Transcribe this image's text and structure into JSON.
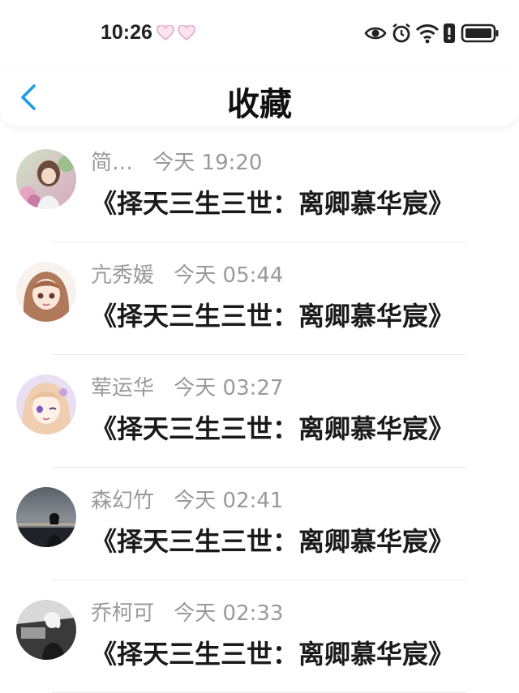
{
  "status_bar": {
    "time": "10:26",
    "icons": [
      "heart-icon",
      "heart-icon",
      "eye-icon",
      "alarm-icon",
      "wifi-icon",
      "alert-icon",
      "battery-icon"
    ]
  },
  "header": {
    "title": "收藏",
    "back_icon": "chevron-left-icon",
    "accent_color": "#1e9be9"
  },
  "favorites": [
    {
      "name": "简…",
      "time": "今天 19:20",
      "content": "《择天三生三世：离卿慕华宸》",
      "avatar": "avatar-girl-flowers"
    },
    {
      "name": "亢秀媛",
      "time": "今天 05:44",
      "content": "《择天三生三世：离卿慕华宸》",
      "avatar": "avatar-anime-girl-brown-hair"
    },
    {
      "name": "荤运华",
      "time": "今天 03:27",
      "content": "《择天三生三世：离卿慕华宸》",
      "avatar": "avatar-anime-girl-wink"
    },
    {
      "name": "森幻竹",
      "time": "今天 02:41",
      "content": "《择天三生三世：离卿慕华宸》",
      "avatar": "avatar-girl-night-city"
    },
    {
      "name": "乔柯可",
      "time": "今天 02:33",
      "content": "《择天三生三世：离卿慕华宸》",
      "avatar": "avatar-girl-bw-car"
    }
  ]
}
